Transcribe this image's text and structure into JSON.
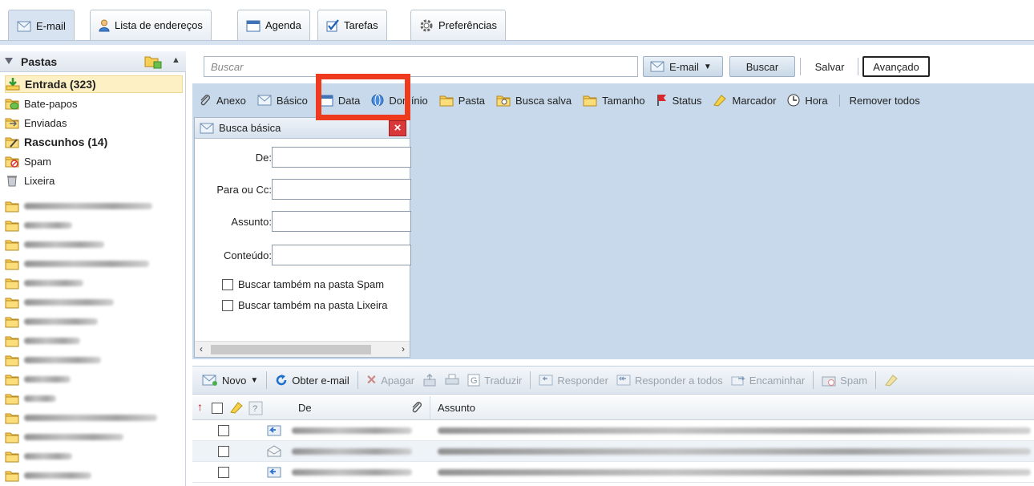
{
  "tabs": [
    {
      "label": "E-mail",
      "icon": "envelope-icon",
      "active": true
    },
    {
      "label": "Lista de endereços",
      "icon": "contacts-icon",
      "active": false
    },
    {
      "label": "Agenda",
      "icon": "calendar-icon",
      "active": false
    },
    {
      "label": "Tarefas",
      "icon": "checkbox-icon",
      "active": false
    },
    {
      "label": "Preferências",
      "icon": "gear-icon",
      "active": false
    }
  ],
  "sidebar": {
    "title": "Pastas",
    "folders": [
      {
        "label": "Entrada (323)",
        "icon": "inbox-icon",
        "bold": true,
        "selected": true
      },
      {
        "label": "Bate-papos",
        "icon": "chat-folder-icon",
        "bold": false
      },
      {
        "label": "Enviadas",
        "icon": "sent-folder-icon",
        "bold": false
      },
      {
        "label": "Rascunhos (14)",
        "icon": "drafts-folder-icon",
        "bold": true
      },
      {
        "label": "Spam",
        "icon": "spam-folder-icon",
        "bold": false
      },
      {
        "label": "Lixeira",
        "icon": "trash-icon",
        "bold": false
      }
    ]
  },
  "search": {
    "placeholder": "Buscar",
    "scope_label": "E-mail",
    "search_button": "Buscar",
    "save_button": "Salvar",
    "advanced_button": "Avançado"
  },
  "filters": {
    "items": [
      "Anexo",
      "Básico",
      "Data",
      "Domínio",
      "Pasta",
      "Busca salva",
      "Tamanho",
      "Status",
      "Marcador",
      "Hora"
    ],
    "remove_all": "Remover todos"
  },
  "basic_search": {
    "title": "Busca básica",
    "from_label": "De:",
    "to_cc_label": "Para ou Cc:",
    "subject_label": "Assunto:",
    "content_label": "Conteúdo:",
    "spam_checkbox": "Buscar também na pasta Spam",
    "trash_checkbox": "Buscar também na pasta Lixeira"
  },
  "toolbar": {
    "new": "Novo",
    "get_mail": "Obter e-mail",
    "delete": "Apagar",
    "translate": "Traduzir",
    "reply": "Responder",
    "reply_all": "Responder a todos",
    "forward": "Encaminhar",
    "spam": "Spam"
  },
  "message_list": {
    "col_from": "De",
    "col_subject": "Assunto"
  },
  "colors": {
    "panel_bg": "#c7d9ea",
    "highlight": "#ef3b1d",
    "folder_yellow": "#f3c94b"
  }
}
